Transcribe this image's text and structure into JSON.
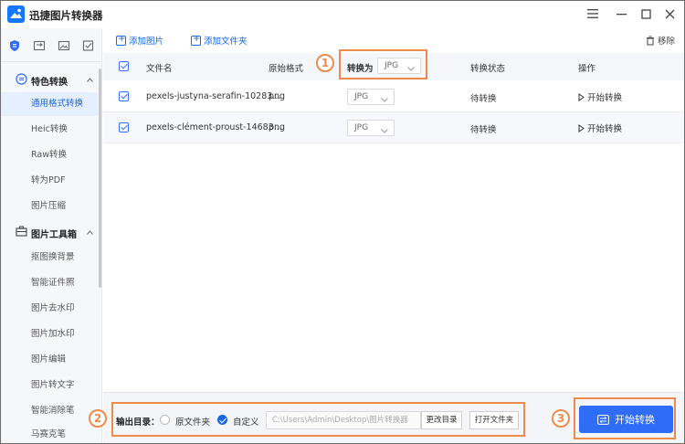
{
  "app": {
    "title": "迅捷图片转换器",
    "accent_color": "#1a66e0"
  },
  "window_controls": {
    "menu_icon": "hamburger-icon",
    "minimize_icon": "minimize-icon",
    "maximize_icon": "maximize-icon",
    "close_icon": "close-icon"
  },
  "sidebar": {
    "top_icons": [
      "shield-icon",
      "convert-icon",
      "image-icon",
      "check-square-icon"
    ],
    "groups": [
      {
        "label": "特色转换",
        "icon": "convert-icon",
        "items": [
          {
            "label": "通用格式转换",
            "active": true
          },
          {
            "label": "Heic转换"
          },
          {
            "label": "Raw转换"
          },
          {
            "label": "转为PDF"
          },
          {
            "label": "图片压缩"
          }
        ]
      },
      {
        "label": "图片工具箱",
        "icon": "toolbox-icon",
        "items": [
          {
            "label": "抠图换背景"
          },
          {
            "label": "智能证件照"
          },
          {
            "label": "图片去水印"
          },
          {
            "label": "图片加水印"
          },
          {
            "label": "图片编辑"
          },
          {
            "label": "图片转文字"
          },
          {
            "label": "智能消除笔"
          },
          {
            "label": "马赛克笔"
          }
        ]
      }
    ]
  },
  "toolbar": {
    "add_image": "添加图片",
    "add_folder": "添加文件夹",
    "remove": "移除"
  },
  "table": {
    "headers": {
      "filename": "文件名",
      "original_format": "原始格式",
      "convert_to": "转换为",
      "convert_to_value": "JPG",
      "status": "转换状态",
      "action": "操作"
    },
    "rows": [
      {
        "filename": "pexels-justyna-serafin-10283...",
        "format": "png",
        "target": "JPG",
        "status": "待转换",
        "action": "开始转换"
      },
      {
        "filename": "pexels-clément-proust-14683...",
        "format": "png",
        "target": "JPG",
        "status": "待转换",
        "action": "开始转换"
      }
    ]
  },
  "output": {
    "label": "输出目录：",
    "option_original": "原文件夹",
    "option_custom": "自定义",
    "path": "C:\\Users\\Admin\\Desktop\\图片转换器",
    "change_dir": "更改目录",
    "open_folder": "打开文件夹",
    "start_button": "开始转换"
  },
  "annotations": [
    "1",
    "2",
    "3"
  ],
  "annotation_color": "#ef8a4d"
}
